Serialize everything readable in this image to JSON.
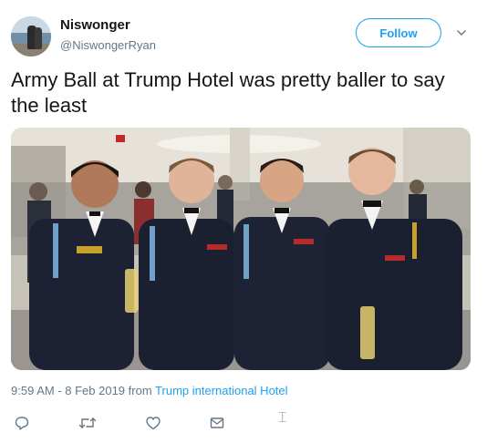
{
  "user": {
    "display_name": "Niswonger",
    "handle": "@NiswongerRyan"
  },
  "follow_button": {
    "label": "Follow"
  },
  "tweet": {
    "text": "Army Ball at Trump Hotel was pretty baller to say the least"
  },
  "media": {
    "icon": "photo-of-four-soldiers-in-dress-uniform"
  },
  "meta": {
    "time": "9:59 AM",
    "separator": " - ",
    "date": "8 Feb 2019",
    "from_label": " from ",
    "source": "Trump international Hotel"
  },
  "actions": {
    "icons": [
      "reply-icon",
      "retweet-icon",
      "like-icon",
      "share-icon"
    ]
  },
  "colors": {
    "brand": "#1da1f2",
    "text": "#14171a",
    "secondary": "#657786"
  }
}
